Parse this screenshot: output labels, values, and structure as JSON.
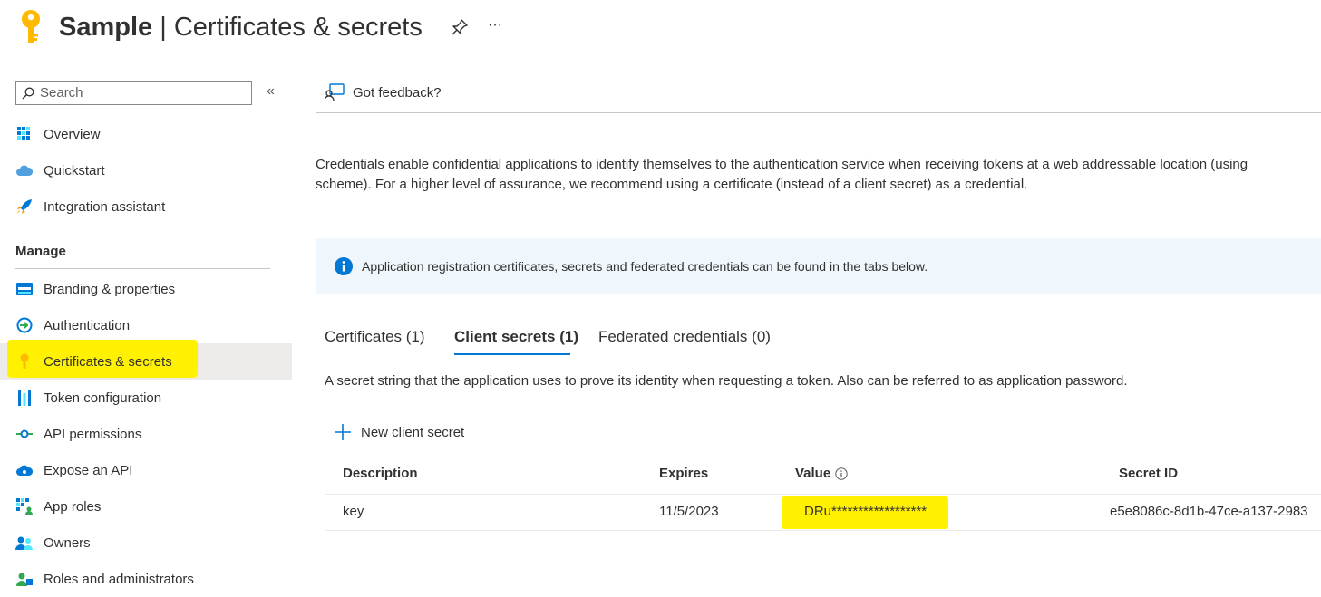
{
  "header": {
    "app_name": "Sample",
    "separator": "|",
    "page_title": "Certificates & secrets",
    "pin_icon": "pin-icon",
    "more_label": "···"
  },
  "sidebar": {
    "search_placeholder": "Search",
    "collapse_label": "«",
    "items": [
      {
        "label": "Overview",
        "icon": "overview-grid-icon"
      },
      {
        "label": "Quickstart",
        "icon": "cloud-quickstart-icon"
      },
      {
        "label": "Integration assistant",
        "icon": "rocket-icon"
      }
    ],
    "manage_header": "Manage",
    "manage_items": [
      {
        "label": "Branding & properties",
        "icon": "branding-icon"
      },
      {
        "label": "Authentication",
        "icon": "authentication-icon"
      },
      {
        "label": "Certificates & secrets",
        "icon": "key-icon",
        "selected": true
      },
      {
        "label": "Token configuration",
        "icon": "token-bars-icon"
      },
      {
        "label": "API permissions",
        "icon": "api-permissions-icon"
      },
      {
        "label": "Expose an API",
        "icon": "cloud-api-icon"
      },
      {
        "label": "App roles",
        "icon": "app-roles-icon"
      },
      {
        "label": "Owners",
        "icon": "owners-icon"
      },
      {
        "label": "Roles and administrators",
        "icon": "roles-admin-icon"
      }
    ]
  },
  "main": {
    "feedback_label": "Got feedback?",
    "description": "Credentials enable confidential applications to identify themselves to the authentication service when receiving tokens at a web addressable location (using",
    "description_line2": "scheme). For a higher level of assurance, we recommend using a certificate (instead of a client secret) as a credential.",
    "info_text": "Application registration certificates, secrets and federated credentials can be found in the tabs below.",
    "tabs": [
      {
        "label": "Certificates (1)",
        "active": false
      },
      {
        "label": "Client secrets (1)",
        "active": true
      },
      {
        "label": "Federated credentials (0)",
        "active": false
      }
    ],
    "tab_description": "A secret string that the application uses to prove its identity when requesting a token. Also can be referred to as application password.",
    "new_secret_label": "New client secret",
    "table": {
      "headers": [
        "Description",
        "Expires",
        "Value",
        "Secret ID"
      ],
      "rows": [
        {
          "description": "key",
          "expires": "11/5/2023",
          "value": "DRu******************",
          "secret_id": "e5e8086c-8d1b-47ce-a137-2983"
        }
      ]
    }
  },
  "colors": {
    "accent": "#0078d4",
    "highlight": "#fff100",
    "selected_bg": "#edebe9",
    "info_bg": "#eff6fc"
  }
}
